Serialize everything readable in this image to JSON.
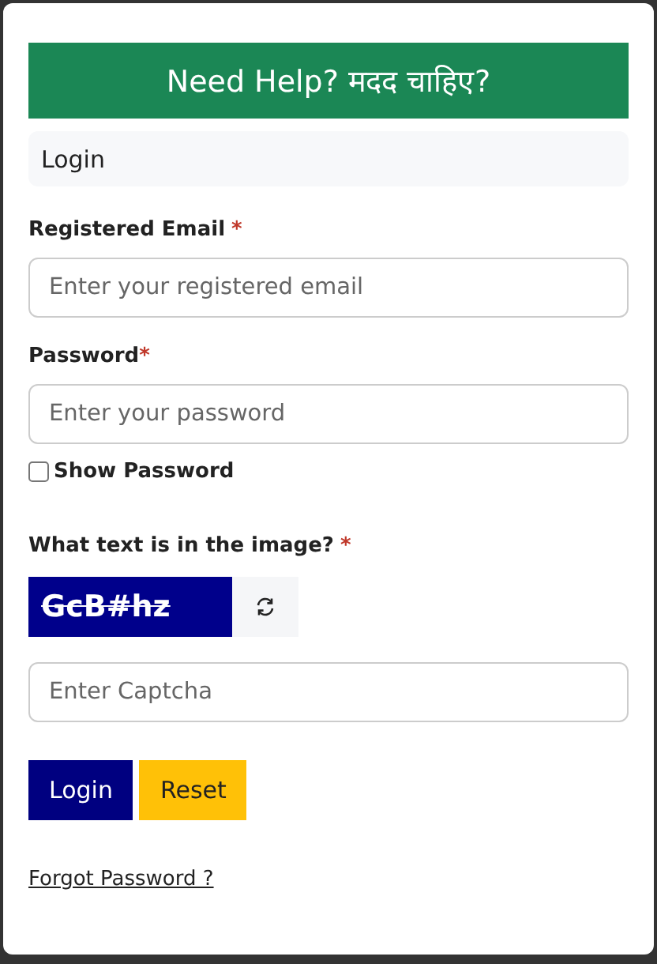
{
  "help_banner": {
    "text": "Need Help? मदद चाहिए?"
  },
  "card_header": {
    "title": "Login"
  },
  "fields": [
    {
      "label": "Registered Email",
      "required_mark": "*",
      "placeholder": "Enter your registered email",
      "kind": "email"
    },
    {
      "label": "Password",
      "required_mark": "*",
      "placeholder": "Enter your password",
      "kind": "password"
    }
  ],
  "show_password": {
    "label": "Show Password",
    "checked": false
  },
  "captcha": {
    "label": "What text is in the image?",
    "required_mark": "*",
    "text": "GcB#hz",
    "placeholder": "Enter Captcha"
  },
  "buttons": [
    {
      "label": "Login",
      "kind": "primary"
    },
    {
      "label": "Reset",
      "kind": "warning"
    }
  ],
  "forgot_link": "Forgot Password ?"
}
